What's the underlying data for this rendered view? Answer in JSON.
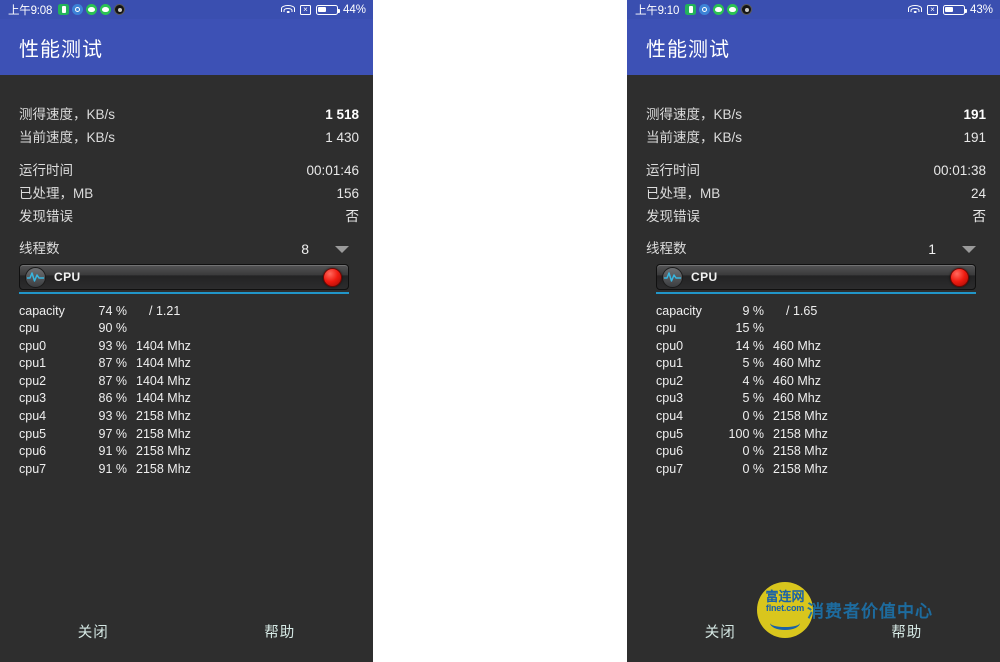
{
  "panels": [
    {
      "status": {
        "time": "上午9:08",
        "battery_percent": "44%",
        "battery_level": 44,
        "icons": [
          "app-green-icon",
          "app-blue-icon",
          "app-wechat-icon",
          "app-wechat-icon",
          "app-dark-icon"
        ],
        "wifi_icon": "wifi-icon",
        "sim_icon": "no-sim-icon"
      },
      "appbar": {
        "title": "性能测试"
      },
      "stats": [
        {
          "label": "测得速度，KB/s",
          "value": "1 518",
          "bold": true
        },
        {
          "label": "当前速度，KB/s",
          "value": "1 430",
          "bold": false
        }
      ],
      "stats2": [
        {
          "label": "运行时间",
          "value": "00:01:46"
        },
        {
          "label": "已处理，MB",
          "value": "156"
        },
        {
          "label": "发现错误",
          "value": "否"
        }
      ],
      "threads": {
        "label": "线程数",
        "value": "8"
      },
      "cpu_widget": {
        "title": "CPU",
        "icon": "pulse-icon",
        "record_button": "record-dot"
      },
      "cpu_rows": [
        {
          "name": "capacity",
          "pct": "74 %",
          "freq": "",
          "cap": "/ 1.21"
        },
        {
          "name": "cpu",
          "pct": "90 %",
          "freq": "",
          "cap": ""
        },
        {
          "name": "cpu0",
          "pct": "93 %",
          "freq": "1404 Mhz",
          "cap": ""
        },
        {
          "name": "cpu1",
          "pct": "87 %",
          "freq": "1404 Mhz",
          "cap": ""
        },
        {
          "name": "cpu2",
          "pct": "87 %",
          "freq": "1404 Mhz",
          "cap": ""
        },
        {
          "name": "cpu3",
          "pct": "86 %",
          "freq": "1404 Mhz",
          "cap": ""
        },
        {
          "name": "cpu4",
          "pct": "93 %",
          "freq": "2158 Mhz",
          "cap": ""
        },
        {
          "name": "cpu5",
          "pct": "97 %",
          "freq": "2158 Mhz",
          "cap": ""
        },
        {
          "name": "cpu6",
          "pct": "91 %",
          "freq": "2158 Mhz",
          "cap": ""
        },
        {
          "name": "cpu7",
          "pct": "91 %",
          "freq": "2158 Mhz",
          "cap": ""
        }
      ],
      "buttons": {
        "close": "关闭",
        "help": "帮助"
      },
      "watermark": null
    },
    {
      "status": {
        "time": "上午9:10",
        "battery_percent": "43%",
        "battery_level": 43,
        "icons": [
          "app-green-icon",
          "app-blue-icon",
          "app-wechat-icon",
          "app-wechat-icon",
          "app-dark-icon"
        ],
        "wifi_icon": "wifi-icon",
        "sim_icon": "no-sim-icon"
      },
      "appbar": {
        "title": "性能测试"
      },
      "stats": [
        {
          "label": "测得速度，KB/s",
          "value": "191",
          "bold": true
        },
        {
          "label": "当前速度，KB/s",
          "value": "191",
          "bold": false
        }
      ],
      "stats2": [
        {
          "label": "运行时间",
          "value": "00:01:38"
        },
        {
          "label": "已处理，MB",
          "value": "24"
        },
        {
          "label": "发现错误",
          "value": "否"
        }
      ],
      "threads": {
        "label": "线程数",
        "value": "1"
      },
      "cpu_widget": {
        "title": "CPU",
        "icon": "pulse-icon",
        "record_button": "record-dot"
      },
      "cpu_rows": [
        {
          "name": "capacity",
          "pct": "9 %",
          "freq": "",
          "cap": "/ 1.65"
        },
        {
          "name": "cpu",
          "pct": "15 %",
          "freq": "",
          "cap": ""
        },
        {
          "name": "cpu0",
          "pct": "14 %",
          "freq": "460 Mhz",
          "cap": ""
        },
        {
          "name": "cpu1",
          "pct": "5 %",
          "freq": "460 Mhz",
          "cap": ""
        },
        {
          "name": "cpu2",
          "pct": "4 %",
          "freq": "460 Mhz",
          "cap": ""
        },
        {
          "name": "cpu3",
          "pct": "5 %",
          "freq": "460 Mhz",
          "cap": ""
        },
        {
          "name": "cpu4",
          "pct": "0 %",
          "freq": "2158 Mhz",
          "cap": ""
        },
        {
          "name": "cpu5",
          "pct": "100 %",
          "freq": "2158 Mhz",
          "cap": ""
        },
        {
          "name": "cpu6",
          "pct": "0 %",
          "freq": "2158 Mhz",
          "cap": ""
        },
        {
          "name": "cpu7",
          "pct": "0 %",
          "freq": "2158 Mhz",
          "cap": ""
        }
      ],
      "buttons": {
        "close": "关闭",
        "help": "帮助"
      },
      "watermark": {
        "logo_cn": "富连网",
        "logo_en": "flnet.com",
        "tagline": "消费者价值中心"
      }
    }
  ],
  "colors": {
    "statusbar": "#3a4fb0",
    "appbar": "#3d51b5",
    "background": "#2e2e2e",
    "accent_underline": "#2196c9",
    "record": "#f01b10",
    "watermark_yellow": "#d9c61d",
    "watermark_blue": "#1a62a8"
  }
}
